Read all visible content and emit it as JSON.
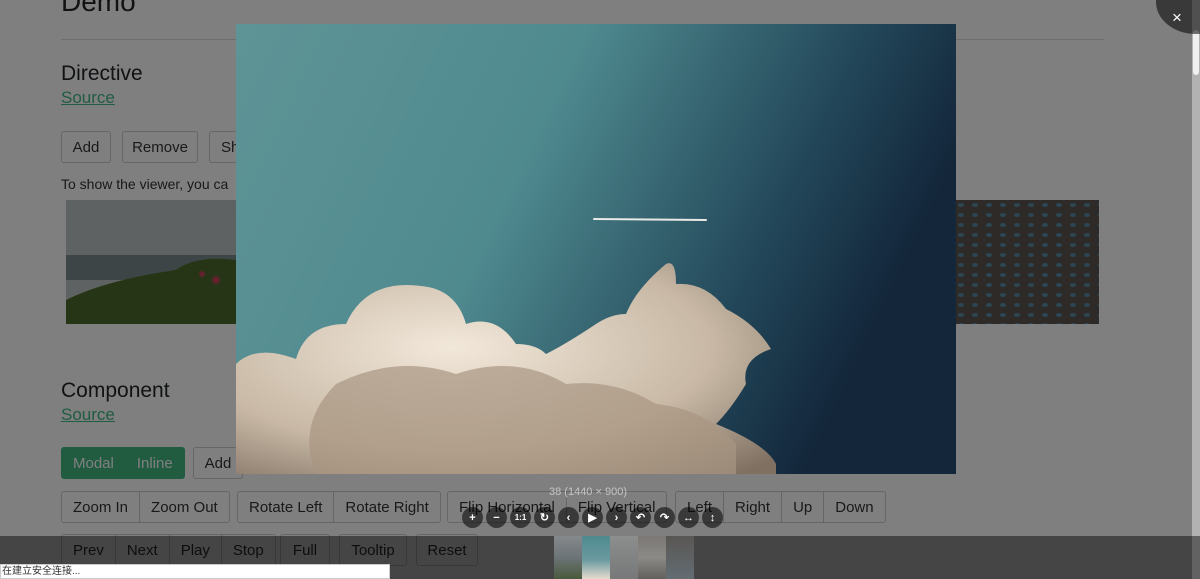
{
  "page": {
    "title": "Demo",
    "directive": {
      "title": "Directive",
      "source": "Source",
      "buttons": [
        "Add",
        "Remove",
        "Sh"
      ],
      "hint": "To show the viewer, you ca"
    },
    "component": {
      "title": "Component",
      "source": "Source",
      "modes": [
        "Modal",
        "Inline"
      ],
      "add_label": "Add",
      "zoom": [
        "Zoom In",
        "Zoom Out"
      ],
      "rotate": [
        "Rotate Left",
        "Rotate Right"
      ],
      "flip": [
        "Flip Horizontal",
        "Flip Vertical"
      ],
      "move": [
        "Left",
        "Right",
        "Up",
        "Down"
      ],
      "play": [
        "Prev",
        "Next",
        "Play",
        "Stop"
      ],
      "full": "Full",
      "tooltip": "Tooltip",
      "reset": "Reset"
    }
  },
  "viewer": {
    "close_label": "×",
    "caption": "38 (1440 × 900)",
    "toolbar": [
      {
        "icon": "zoom-in-icon",
        "glyph": "+"
      },
      {
        "icon": "zoom-out-icon",
        "glyph": "−"
      },
      {
        "icon": "one-to-one-icon",
        "glyph": "1:1"
      },
      {
        "icon": "reset-icon",
        "glyph": "↻"
      },
      {
        "icon": "prev-icon",
        "glyph": "‹"
      },
      {
        "icon": "play-icon",
        "glyph": "▶"
      },
      {
        "icon": "next-icon",
        "glyph": "›"
      },
      {
        "icon": "rotate-left-icon",
        "glyph": "↶"
      },
      {
        "icon": "rotate-right-icon",
        "glyph": "↷"
      },
      {
        "icon": "flip-horizontal-icon",
        "glyph": "↔"
      },
      {
        "icon": "flip-vertical-icon",
        "glyph": "↕"
      }
    ],
    "thumbnails": [
      {
        "icon": "thumbnail-coast",
        "active": false
      },
      {
        "icon": "thumbnail-clouds",
        "active": true
      },
      {
        "icon": "thumbnail-gray",
        "active": false
      },
      {
        "icon": "thumbnail-leaf",
        "active": false
      },
      {
        "icon": "thumbnail-drops",
        "active": false
      }
    ]
  },
  "status_bar": {
    "text": "在建立安全连接..."
  },
  "colors": {
    "accent": "#42b983",
    "link": "#41b883"
  }
}
